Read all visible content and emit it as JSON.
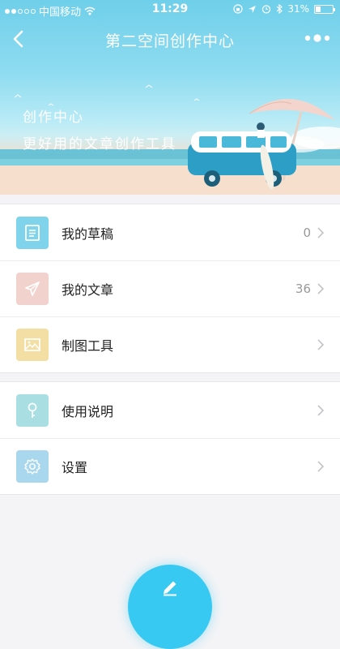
{
  "status_bar": {
    "carrier": "中国移动",
    "time": "11:29",
    "battery": "31%"
  },
  "nav": {
    "title": "第二空间创作中心",
    "back_icon": "chevron-left-icon",
    "more_icon": "more-dots-icon"
  },
  "hero": {
    "line1": "创作中心",
    "line2": "更好用的文章创作工具"
  },
  "menu_group_1": [
    {
      "label": "我的草稿",
      "count": "0",
      "icon": "draft-document-icon",
      "icon_bg": "#7fd3ea"
    },
    {
      "label": "我的文章",
      "count": "36",
      "icon": "paper-plane-icon",
      "icon_bg": "#f1d2cc"
    },
    {
      "label": "制图工具",
      "count": "",
      "icon": "image-icon",
      "icon_bg": "#f3dfa4"
    }
  ],
  "menu_group_2": [
    {
      "label": "使用说明",
      "icon": "key-icon",
      "icon_bg": "#a9dfe3"
    },
    {
      "label": "设置",
      "icon": "gear-icon",
      "icon_bg": "#a8d7ee"
    }
  ],
  "fab": {
    "icon": "pencil-icon",
    "color": "#38c9f3"
  }
}
